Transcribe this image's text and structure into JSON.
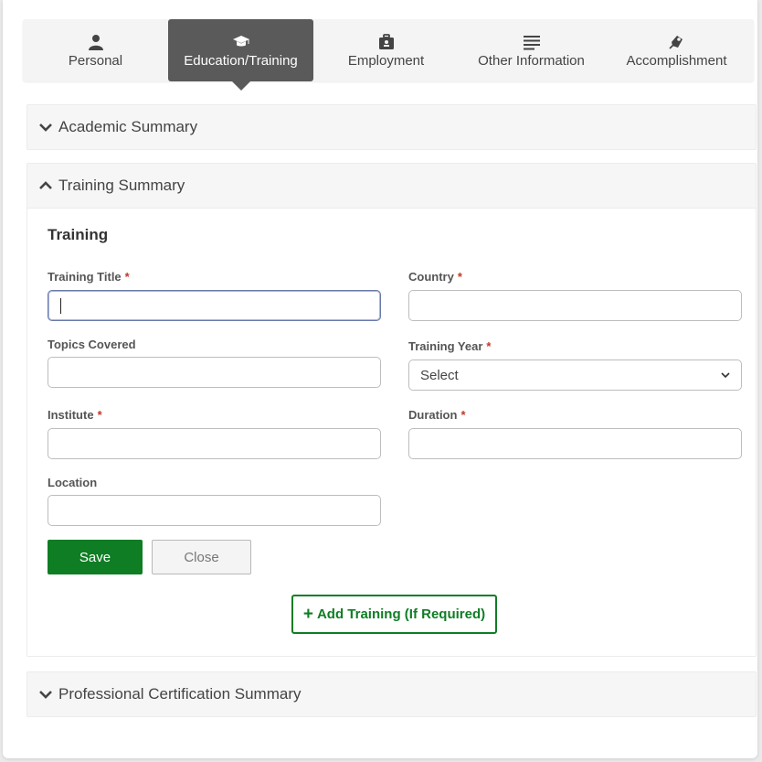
{
  "tabs": [
    {
      "label": "Personal",
      "icon": "person-icon",
      "active": false
    },
    {
      "label": "Education/Training",
      "icon": "graduation-cap-icon",
      "active": true
    },
    {
      "label": "Employment",
      "icon": "briefcase-icon",
      "active": false
    },
    {
      "label": "Other Information",
      "icon": "text-lines-icon",
      "active": false
    },
    {
      "label": "Accomplishment",
      "icon": "award-icon",
      "active": false
    }
  ],
  "panels": {
    "academic": {
      "title": "Academic Summary",
      "expanded": false
    },
    "training": {
      "title": "Training Summary",
      "expanded": true
    },
    "professional": {
      "title": "Professional Certification Summary",
      "expanded": false
    }
  },
  "training_form": {
    "section_title": "Training",
    "required_mark": "*",
    "fields": {
      "training_title": {
        "label": "Training Title",
        "value": "",
        "required": true
      },
      "country": {
        "label": "Country",
        "value": "",
        "required": true
      },
      "topics_covered": {
        "label": "Topics Covered",
        "value": "",
        "required": false
      },
      "training_year": {
        "label": "Training Year",
        "value": "Select",
        "required": true
      },
      "institute": {
        "label": "Institute",
        "value": "",
        "required": true
      },
      "duration": {
        "label": "Duration",
        "value": "",
        "required": true
      },
      "location": {
        "label": "Location",
        "value": "",
        "required": false
      }
    },
    "save_label": "Save",
    "close_label": "Close",
    "add_label": "Add Training (If Required)",
    "add_icon": "+"
  },
  "colors": {
    "primary_green": "#0f7d24",
    "active_tab": "#5a5a5a",
    "required": "#c0392b"
  }
}
